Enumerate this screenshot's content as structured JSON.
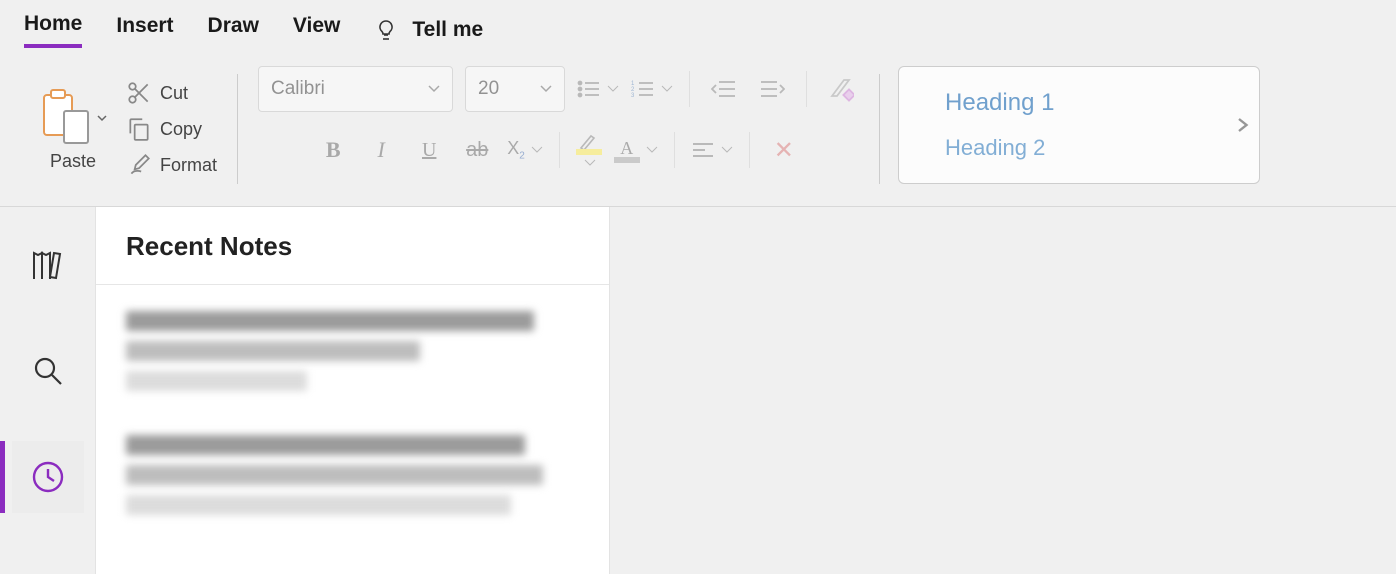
{
  "tabs": {
    "home": "Home",
    "insert": "Insert",
    "draw": "Draw",
    "view": "View",
    "tellme": "Tell me"
  },
  "clipboard": {
    "paste": "Paste",
    "cut": "Cut",
    "copy": "Copy",
    "format": "Format"
  },
  "font": {
    "name": "Calibri",
    "size": "20"
  },
  "styles": {
    "heading1": "Heading 1",
    "heading2": "Heading 2"
  },
  "sidebar": {
    "notebooks": "Notebooks",
    "search": "Search",
    "recent": "Recent"
  },
  "notelist": {
    "title": "Recent Notes"
  }
}
